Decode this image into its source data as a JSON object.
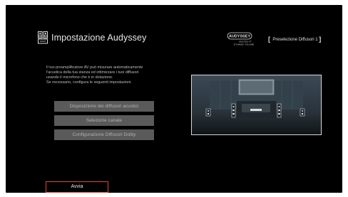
{
  "header": {
    "title": "Impostazione Audyssey",
    "logo": {
      "brand": "AUDYSSEY",
      "subtitle_line1": "MULTEQ XT",
      "subtitle_line2": "DYNAMIC VOLUME"
    },
    "preset_label": "Preselezione Diffusori 1"
  },
  "description": [
    "Il tuo preamplificatore AV può misurare automaticamente",
    "l'acustica della tua stanza ed ottimizzare i tuoi diffusori",
    "usando il microfono che è in dotazione.",
    "Se necessario, configura le seguenti impostazioni."
  ],
  "menu": [
    "Disposizione dei diffusori acustici",
    "Selezione canale",
    "Configurazione Diffusori Dolby"
  ],
  "start_button": "Avvia",
  "icons": {
    "header": "speaker-icon"
  },
  "colors": {
    "screen_bg": "#000000",
    "button_bg": "#5a5a5a",
    "accent_border": "#e04a3a"
  }
}
